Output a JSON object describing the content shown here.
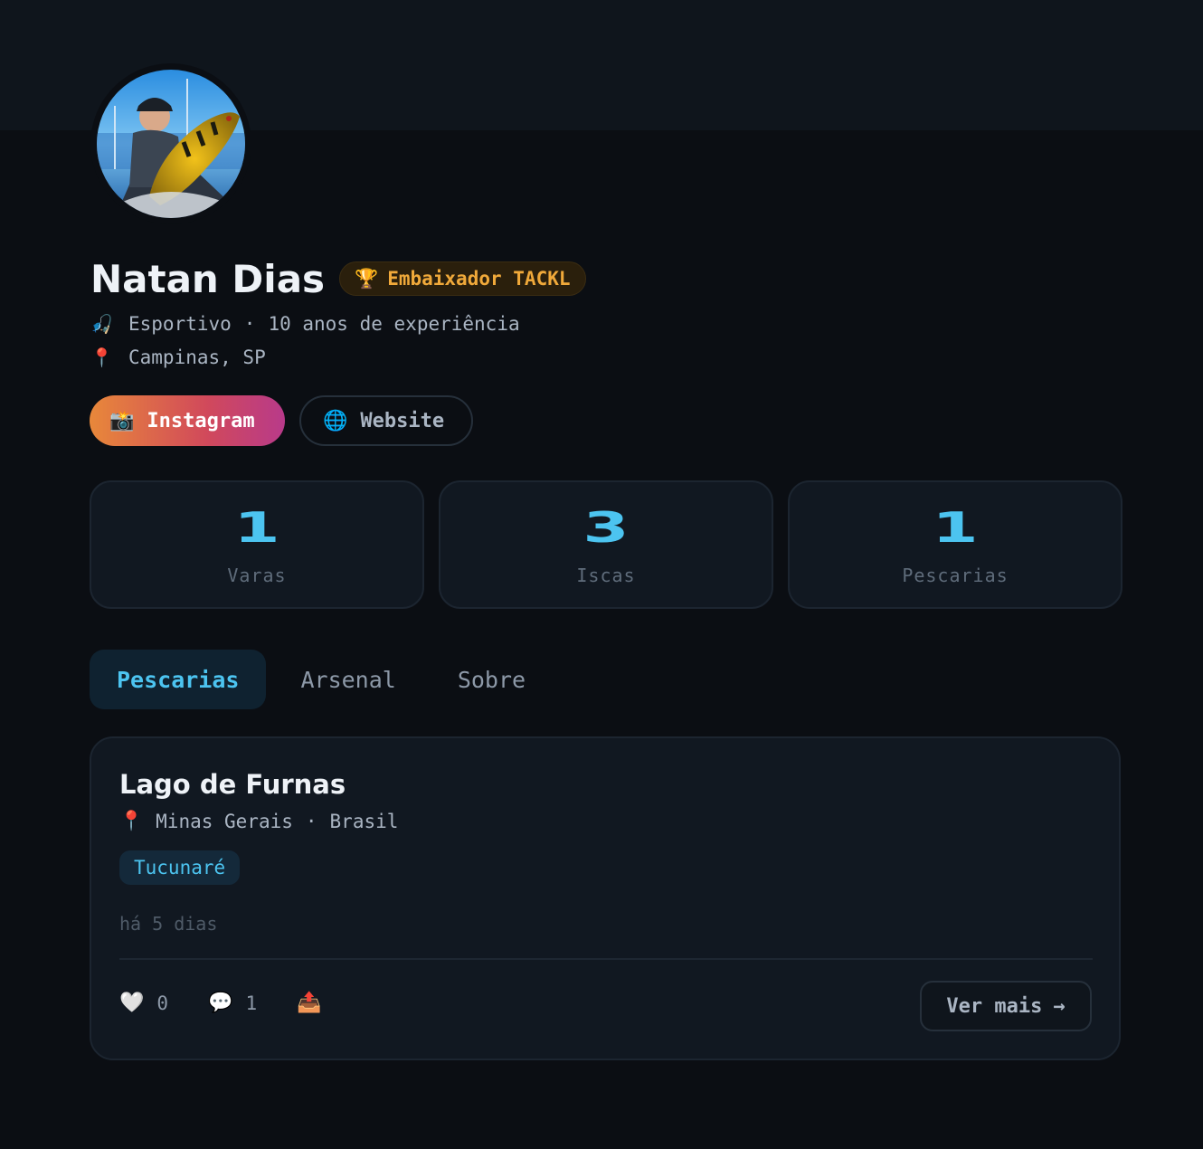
{
  "profile": {
    "name": "Natan Dias",
    "badge_icon": "trophy-icon",
    "badge_label": "Embaixador TACKL",
    "style": "Esportivo",
    "separator": "·",
    "experience": "10 anos de experiência",
    "location": "Campinas, SP"
  },
  "links": {
    "instagram_label": "Instagram",
    "website_label": "Website"
  },
  "stats": [
    {
      "value": "1",
      "label": "Varas"
    },
    {
      "value": "3",
      "label": "Iscas"
    },
    {
      "value": "1",
      "label": "Pescarias"
    }
  ],
  "tabs": [
    {
      "label": "Pescarias",
      "active": true
    },
    {
      "label": "Arsenal",
      "active": false
    },
    {
      "label": "Sobre",
      "active": false
    }
  ],
  "post": {
    "title": "Lago de Furnas",
    "region": "Minas Gerais",
    "separator": "·",
    "country": "Brasil",
    "species": "Tucunaré",
    "time_ago": "há 5 dias",
    "likes": "0",
    "comments": "1",
    "more_label": "Ver mais",
    "more_arrow": "→"
  },
  "colors": {
    "background": "#0b0e13",
    "card": "#111821",
    "accent": "#4cc4f0",
    "badge_text": "#f0a93a"
  }
}
